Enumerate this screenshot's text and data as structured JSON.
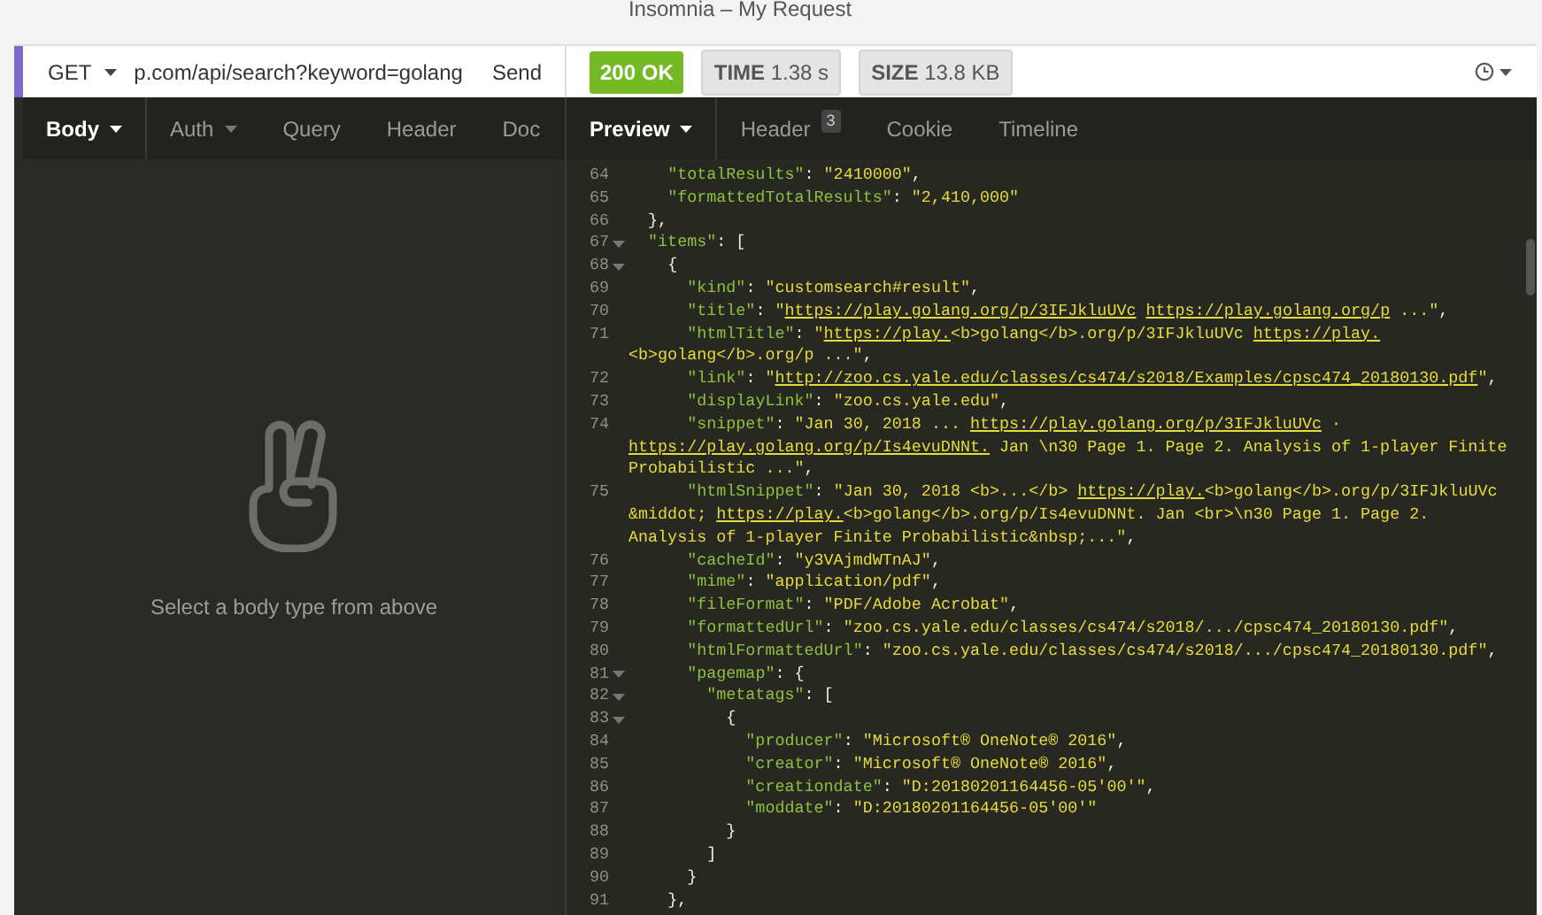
{
  "window": {
    "title": "Insomnia – My Request"
  },
  "request": {
    "method": "GET",
    "url": "p.com/api/search?keyword=golang",
    "send": "Send"
  },
  "response": {
    "status": "200 OK",
    "time_label": "TIME",
    "time": "1.38 s",
    "size_label": "SIZE",
    "size": "13.8 KB"
  },
  "request_tabs": [
    {
      "label": "Body",
      "selected": true,
      "dropdown": true
    },
    {
      "label": "Auth",
      "selected": false,
      "dropdown": true
    },
    {
      "label": "Query",
      "selected": false,
      "dropdown": false
    },
    {
      "label": "Header",
      "selected": false,
      "dropdown": false
    },
    {
      "label": "Doc",
      "selected": false,
      "dropdown": false
    }
  ],
  "response_tabs": [
    {
      "label": "Preview",
      "selected": true,
      "dropdown": true
    },
    {
      "label": "Header",
      "selected": false,
      "dropdown": false,
      "count": "3"
    },
    {
      "label": "Cookie",
      "selected": false,
      "dropdown": false
    },
    {
      "label": "Timeline",
      "selected": false,
      "dropdown": false
    }
  ],
  "body_empty": {
    "message": "Select a body type from above"
  },
  "code_lines": [
    {
      "num": "64",
      "fold": false,
      "segs": [
        {
          "kind": "key",
          "text": "    \"totalResults\""
        },
        {
          "kind": "punct",
          "text": ": "
        },
        {
          "kind": "str",
          "text": "\"2410000\""
        },
        {
          "kind": "punct",
          "text": ","
        }
      ]
    },
    {
      "num": "65",
      "fold": false,
      "segs": [
        {
          "kind": "key",
          "text": "    \"formattedTotalResults\""
        },
        {
          "kind": "punct",
          "text": ": "
        },
        {
          "kind": "str",
          "text": "\"2,410,000\""
        }
      ]
    },
    {
      "num": "66",
      "fold": false,
      "segs": [
        {
          "kind": "punct",
          "text": "  },"
        }
      ]
    },
    {
      "num": "67",
      "fold": true,
      "segs": [
        {
          "kind": "key",
          "text": "  \"items\""
        },
        {
          "kind": "punct",
          "text": ": ["
        }
      ]
    },
    {
      "num": "68",
      "fold": true,
      "segs": [
        {
          "kind": "punct",
          "text": "    {"
        }
      ]
    },
    {
      "num": "69",
      "fold": false,
      "segs": [
        {
          "kind": "key",
          "text": "      \"kind\""
        },
        {
          "kind": "punct",
          "text": ": "
        },
        {
          "kind": "str",
          "text": "\"customsearch#result\""
        },
        {
          "kind": "punct",
          "text": ","
        }
      ]
    },
    {
      "num": "70",
      "fold": false,
      "segs": [
        {
          "kind": "key",
          "text": "      \"title\""
        },
        {
          "kind": "punct",
          "text": ": "
        },
        {
          "kind": "str",
          "text": "\""
        },
        {
          "kind": "link",
          "text": "https://play.golang.org/p/3IFJkluUVc"
        },
        {
          "kind": "link",
          "text": " https://play.golang.org/p"
        },
        {
          "kind": "str",
          "text": " ...\""
        },
        {
          "kind": "punct",
          "text": ","
        }
      ]
    },
    {
      "num": "71",
      "fold": false,
      "segs": [
        {
          "kind": "key",
          "text": "      \"htmlTitle\""
        },
        {
          "kind": "punct",
          "text": ": "
        },
        {
          "kind": "str",
          "text": "\""
        },
        {
          "kind": "link",
          "text": "https://play."
        },
        {
          "kind": "str",
          "text": "<b>golang</b>.org/p/3IFJkluUVc "
        },
        {
          "kind": "link",
          "text": "https://play."
        }
      ]
    },
    {
      "segs": [
        {
          "kind": "str",
          "text": "<b>golang</b>.org/p ...\""
        },
        {
          "kind": "punct",
          "text": ","
        }
      ]
    },
    {
      "num": "72",
      "fold": false,
      "segs": [
        {
          "kind": "key",
          "text": "      \"link\""
        },
        {
          "kind": "punct",
          "text": ": "
        },
        {
          "kind": "str",
          "text": "\""
        },
        {
          "kind": "link",
          "text": "http://zoo.cs.yale.edu/classes/cs474/s2018/Examples/cpsc474_20180130.pdf"
        },
        {
          "kind": "str",
          "text": "\""
        },
        {
          "kind": "punct",
          "text": ","
        }
      ]
    },
    {
      "num": "73",
      "fold": false,
      "segs": [
        {
          "kind": "key",
          "text": "      \"displayLink\""
        },
        {
          "kind": "punct",
          "text": ": "
        },
        {
          "kind": "str",
          "text": "\"zoo.cs.yale.edu\""
        },
        {
          "kind": "punct",
          "text": ","
        }
      ]
    },
    {
      "num": "74",
      "fold": false,
      "segs": [
        {
          "kind": "key",
          "text": "      \"snippet\""
        },
        {
          "kind": "punct",
          "text": ": "
        },
        {
          "kind": "str",
          "text": "\"Jan 30, 2018 ... "
        },
        {
          "kind": "link",
          "text": "https://play.golang.org/p/3IFJkluUVc"
        },
        {
          "kind": "str",
          "text": " ·"
        }
      ]
    },
    {
      "segs": [
        {
          "kind": "link",
          "text": "https://play.golang.org/p/Is4evuDNNt."
        },
        {
          "kind": "str",
          "text": " Jan \\n30 Page 1. Page 2. Analysis of 1-player Finite"
        }
      ]
    },
    {
      "segs": [
        {
          "kind": "str",
          "text": "Probabilistic ...\""
        },
        {
          "kind": "punct",
          "text": ","
        }
      ]
    },
    {
      "num": "75",
      "fold": false,
      "segs": [
        {
          "kind": "key",
          "text": "      \"htmlSnippet\""
        },
        {
          "kind": "punct",
          "text": ": "
        },
        {
          "kind": "str",
          "text": "\"Jan 30, 2018 <b>...</b> "
        },
        {
          "kind": "link",
          "text": "https://play."
        },
        {
          "kind": "str",
          "text": "<b>golang</b>.org/p/3IFJkluUVc"
        }
      ]
    },
    {
      "segs": [
        {
          "kind": "str",
          "text": "&middot; "
        },
        {
          "kind": "link",
          "text": "https://play."
        },
        {
          "kind": "str",
          "text": "<b>golang</b>.org/p/Is4evuDNNt. Jan <br>\\n30 Page 1. Page 2."
        }
      ]
    },
    {
      "segs": [
        {
          "kind": "str",
          "text": "Analysis of 1-player Finite Probabilistic&nbsp;...\""
        },
        {
          "kind": "punct",
          "text": ","
        }
      ]
    },
    {
      "num": "76",
      "fold": false,
      "segs": [
        {
          "kind": "key",
          "text": "      \"cacheId\""
        },
        {
          "kind": "punct",
          "text": ": "
        },
        {
          "kind": "str",
          "text": "\"y3VAjmdWTnAJ\""
        },
        {
          "kind": "punct",
          "text": ","
        }
      ]
    },
    {
      "num": "77",
      "fold": false,
      "segs": [
        {
          "kind": "key",
          "text": "      \"mime\""
        },
        {
          "kind": "punct",
          "text": ": "
        },
        {
          "kind": "str",
          "text": "\"application/pdf\""
        },
        {
          "kind": "punct",
          "text": ","
        }
      ]
    },
    {
      "num": "78",
      "fold": false,
      "segs": [
        {
          "kind": "key",
          "text": "      \"fileFormat\""
        },
        {
          "kind": "punct",
          "text": ": "
        },
        {
          "kind": "str",
          "text": "\"PDF/Adobe Acrobat\""
        },
        {
          "kind": "punct",
          "text": ","
        }
      ]
    },
    {
      "num": "79",
      "fold": false,
      "segs": [
        {
          "kind": "key",
          "text": "      \"formattedUrl\""
        },
        {
          "kind": "punct",
          "text": ": "
        },
        {
          "kind": "str",
          "text": "\"zoo.cs.yale.edu/classes/cs474/s2018/.../cpsc474_20180130.pdf\""
        },
        {
          "kind": "punct",
          "text": ","
        }
      ]
    },
    {
      "num": "80",
      "fold": false,
      "segs": [
        {
          "kind": "key",
          "text": "      \"htmlFormattedUrl\""
        },
        {
          "kind": "punct",
          "text": ": "
        },
        {
          "kind": "str",
          "text": "\"zoo.cs.yale.edu/classes/cs474/s2018/.../cpsc474_20180130.pdf\""
        },
        {
          "kind": "punct",
          "text": ","
        }
      ]
    },
    {
      "num": "81",
      "fold": true,
      "segs": [
        {
          "kind": "key",
          "text": "      \"pagemap\""
        },
        {
          "kind": "punct",
          "text": ": {"
        }
      ]
    },
    {
      "num": "82",
      "fold": true,
      "segs": [
        {
          "kind": "key",
          "text": "        \"metatags\""
        },
        {
          "kind": "punct",
          "text": ": ["
        }
      ]
    },
    {
      "num": "83",
      "fold": true,
      "segs": [
        {
          "kind": "punct",
          "text": "          {"
        }
      ]
    },
    {
      "num": "84",
      "fold": false,
      "segs": [
        {
          "kind": "key",
          "text": "            \"producer\""
        },
        {
          "kind": "punct",
          "text": ": "
        },
        {
          "kind": "str",
          "text": "\"Microsoft® OneNote® 2016\""
        },
        {
          "kind": "punct",
          "text": ","
        }
      ]
    },
    {
      "num": "85",
      "fold": false,
      "segs": [
        {
          "kind": "key",
          "text": "            \"creator\""
        },
        {
          "kind": "punct",
          "text": ": "
        },
        {
          "kind": "str",
          "text": "\"Microsoft® OneNote® 2016\""
        },
        {
          "kind": "punct",
          "text": ","
        }
      ]
    },
    {
      "num": "86",
      "fold": false,
      "segs": [
        {
          "kind": "key",
          "text": "            \"creationdate\""
        },
        {
          "kind": "punct",
          "text": ": "
        },
        {
          "kind": "str",
          "text": "\"D:20180201164456-05'00'\""
        },
        {
          "kind": "punct",
          "text": ","
        }
      ]
    },
    {
      "num": "87",
      "fold": false,
      "segs": [
        {
          "kind": "key",
          "text": "            \"moddate\""
        },
        {
          "kind": "punct",
          "text": ": "
        },
        {
          "kind": "str",
          "text": "\"D:20180201164456-05'00'\""
        }
      ]
    },
    {
      "num": "88",
      "fold": false,
      "segs": [
        {
          "kind": "punct",
          "text": "          }"
        }
      ]
    },
    {
      "num": "89",
      "fold": false,
      "segs": [
        {
          "kind": "punct",
          "text": "        ]"
        }
      ]
    },
    {
      "num": "90",
      "fold": false,
      "segs": [
        {
          "kind": "punct",
          "text": "      }"
        }
      ]
    },
    {
      "num": "91",
      "fold": false,
      "segs": [
        {
          "kind": "punct",
          "text": "    },"
        }
      ]
    }
  ]
}
